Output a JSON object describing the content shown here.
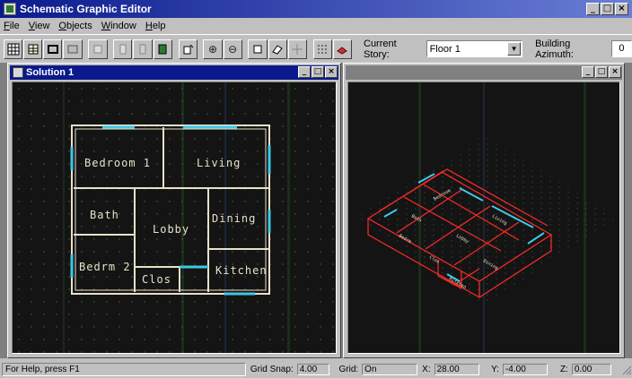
{
  "app": {
    "title": "Schematic Graphic Editor"
  },
  "menu": [
    "File",
    "View",
    "Objects",
    "Window",
    "Help"
  ],
  "toolbar": {
    "story_label": "Current Story:",
    "story_value": "Floor 1",
    "azimuth_label": "Building Azimuth:",
    "azimuth_value": "0",
    "icons": [
      "grid-icon",
      "layers-icon",
      "frame-icon",
      "open-icon",
      "copy-icon",
      "text-icon",
      "page-icon",
      "door-icon",
      "window-icon",
      "zoom-in-icon",
      "zoom-out-icon",
      "select-icon",
      "eraser-icon",
      "move-icon",
      "snap-grid-icon",
      "render-icon"
    ]
  },
  "windows": {
    "left_title": "Solution 1",
    "right_title": ""
  },
  "floorplan": {
    "rooms": [
      "Bedroom 1",
      "Living",
      "Bath",
      "Lobby",
      "Dining",
      "Bedrm 2",
      "Clos",
      "Kitchen"
    ],
    "colors": {
      "walls": "#e8e2c8",
      "openings": "#3ec8e8",
      "labels": "#e8e2c8",
      "grid": "#3a6a3a"
    }
  },
  "iso": {
    "colors": {
      "walls": "#ff2a2a",
      "openings": "#3ec8e8"
    }
  },
  "status": {
    "help": "For Help, press F1",
    "grid_snap_label": "Grid Snap:",
    "grid_snap_value": "4.00",
    "grid_label": "Grid:",
    "grid_value": "On",
    "x_label": "X:",
    "x_value": "28.00",
    "y_label": "Y:",
    "y_value": "-4.00",
    "z_label": "Z:",
    "z_value": "0.00"
  }
}
